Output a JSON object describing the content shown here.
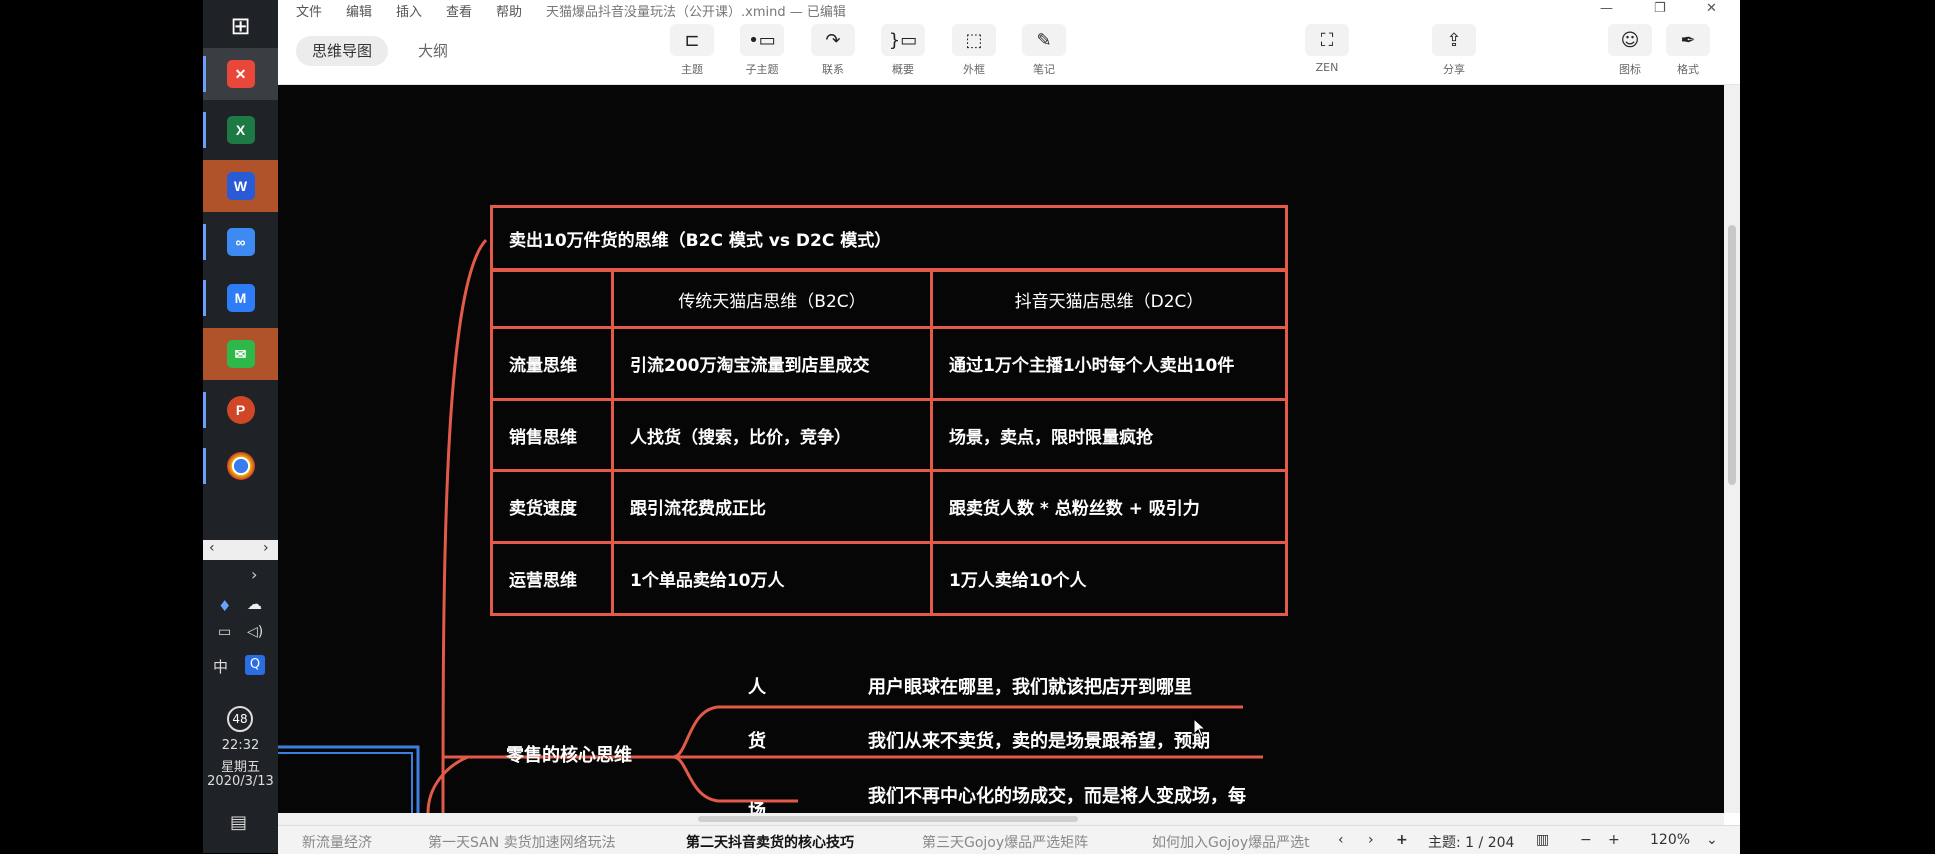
{
  "taskbar": {
    "apps": [
      {
        "name": "windows-start-icon",
        "glyph": "⊞"
      },
      {
        "name": "xmind-app-icon",
        "glyph": "✕",
        "color": "#e8473a"
      },
      {
        "name": "excel-app-icon",
        "glyph": "X",
        "color": "#1e7a45"
      },
      {
        "name": "word-app-icon",
        "glyph": "W",
        "color": "#2a5bd7"
      },
      {
        "name": "baidu-netdisk-app-icon",
        "glyph": "∞",
        "color": "#3d8bf2"
      },
      {
        "name": "feishu-app-icon",
        "glyph": "M",
        "color": "#2e7df6"
      },
      {
        "name": "wechat-app-icon",
        "glyph": "✉",
        "color": "#2fb84a"
      },
      {
        "name": "powerpoint-app-icon",
        "glyph": "P",
        "color": "#d04727"
      },
      {
        "name": "chrome-app-icon",
        "glyph": "●",
        "color": "#e6b800"
      }
    ],
    "tray": {
      "ime": "中",
      "badge": "48",
      "time": "22:32",
      "weekday": "星期五",
      "date": "2020/3/13"
    }
  },
  "window": {
    "menu": [
      "文件",
      "编辑",
      "插入",
      "查看",
      "帮助"
    ],
    "title": "天猫爆品抖音没量玩法（公开课）.xmind — 已编辑",
    "view_tabs": [
      "思维导图",
      "大纲"
    ],
    "tools": [
      {
        "label": "主题",
        "icon": "topic-icon",
        "glyph": "⊏"
      },
      {
        "label": "子主题",
        "icon": "subtopic-icon",
        "glyph": "•▭"
      },
      {
        "label": "联系",
        "icon": "relationship-icon",
        "glyph": "↷"
      },
      {
        "label": "概要",
        "icon": "summary-icon",
        "glyph": "}▭"
      },
      {
        "label": "外框",
        "icon": "boundary-icon",
        "glyph": "⬚"
      },
      {
        "label": "笔记",
        "icon": "note-icon",
        "glyph": "✎"
      },
      {
        "label": "ZEN",
        "icon": "zen-icon",
        "glyph": "⛶"
      },
      {
        "label": "分享",
        "icon": "share-icon",
        "glyph": "⇪"
      },
      {
        "label": "图标",
        "icon": "emoji-icon",
        "glyph": "☺"
      },
      {
        "label": "格式",
        "icon": "format-icon",
        "glyph": "✒"
      }
    ],
    "window_controls": [
      "—",
      "❐",
      "✕"
    ]
  },
  "mindmap": {
    "table_title": "卖出10万件货的思维（B2C 模式 vs D2C 模式）",
    "headers": [
      "",
      "传统天猫店思维（B2C）",
      "抖音天猫店思维（D2C）"
    ],
    "rows": [
      [
        "流量思维",
        "引流200万淘宝流量到店里成交",
        "通过1万个主播1小时每个人卖出10件"
      ],
      [
        "销售思维",
        "人找货（搜索，比价，竞争）",
        "场景，卖点，限时限量疯抢"
      ],
      [
        "卖货速度",
        "跟引流花费成正比",
        "跟卖货人数 * 总粉丝数 + 吸引力"
      ],
      [
        "运营思维",
        "1个单品卖给10万人",
        "1万人卖给10个人"
      ]
    ],
    "branch": {
      "label": "零售的核心思维",
      "children": [
        {
          "key": "人",
          "text": "用户眼球在哪里，我们就该把店开到哪里"
        },
        {
          "key": "货",
          "text": "我们从来不卖货，卖的是场景跟希望，预期"
        },
        {
          "key": "场",
          "text": "我们不再中心化的场成交，而是将人变成场，每"
        }
      ]
    },
    "colors": {
      "line": "#e25a48",
      "blue": "#3d7fe0"
    }
  },
  "sheets": {
    "tabs": [
      "新流量经济",
      "第一天SAN 卖货加速网络玩法",
      "第二天抖音卖货的核心技巧",
      "第三天Gojoy爆品严选矩阵",
      "如何加入Gojoy爆品严选t"
    ],
    "selected_index": 2,
    "topic_count": "主题: 1 / 204",
    "zoom": "120%"
  }
}
